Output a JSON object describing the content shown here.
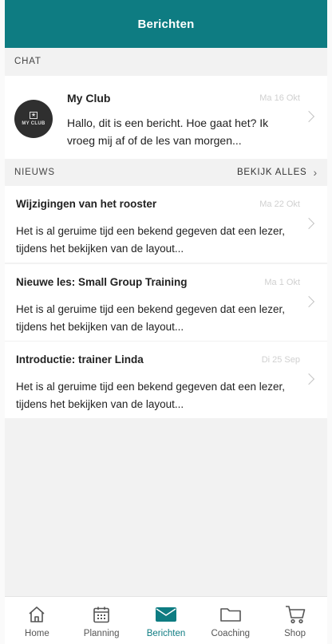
{
  "header": {
    "title": "Berichten"
  },
  "colors": {
    "accent": "#0e7c82",
    "date_text": "#d0d0d0"
  },
  "chat_section": {
    "label": "CHAT"
  },
  "chat": {
    "avatar_text": "MY CLUB",
    "name": "My Club",
    "date": "Ma 16 Okt",
    "message": "Hallo, dit is een bericht. Hoe gaat het? Ik vroeg mij af of de les van morgen..."
  },
  "news_section": {
    "label": "NIEUWS",
    "see_all": "BEKIJK ALLES"
  },
  "news": [
    {
      "title": "Wijzigingen van het rooster",
      "date": "Ma 22 Okt",
      "message": "Het is al geruime tijd een bekend gegeven dat een lezer, tijdens het bekijken van de layout..."
    },
    {
      "title": "Nieuwe les: Small Group Training",
      "date": "Ma 1 Okt",
      "message": "Het is al geruime tijd een bekend gegeven dat een lezer, tijdens het bekijken van de layout..."
    },
    {
      "title": "Introductie: trainer Linda",
      "date": "Di 25 Sep",
      "message": "Het is al geruime tijd een bekend gegeven dat een lezer, tijdens het bekijken van de layout..."
    }
  ],
  "tabs": [
    {
      "label": "Home",
      "icon": "home-icon"
    },
    {
      "label": "Planning",
      "icon": "calendar-icon"
    },
    {
      "label": "Berichten",
      "icon": "mail-icon",
      "active": true
    },
    {
      "label": "Coaching",
      "icon": "folder-icon"
    },
    {
      "label": "Shop",
      "icon": "cart-icon"
    }
  ]
}
